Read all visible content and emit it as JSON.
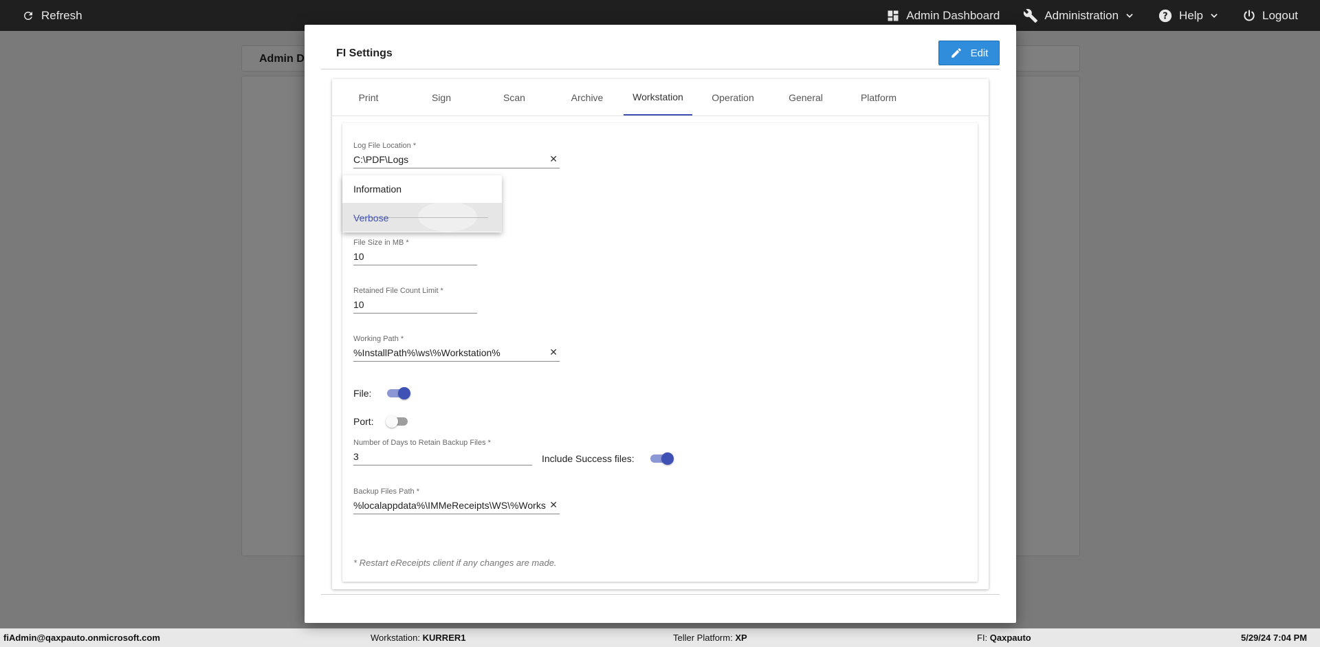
{
  "topbar": {
    "refresh_label": "Refresh",
    "admin_dashboard_label": "Admin Dashboard",
    "administration_label": "Administration",
    "help_label": "Help",
    "logout_label": "Logout"
  },
  "background": {
    "panel_title": "Admin D"
  },
  "modal": {
    "title": "FI Settings",
    "edit_label": "Edit",
    "tabs": [
      {
        "label": "Print"
      },
      {
        "label": "Sign"
      },
      {
        "label": "Scan"
      },
      {
        "label": "Archive"
      },
      {
        "label": "Workstation"
      },
      {
        "label": "Operation"
      },
      {
        "label": "General"
      },
      {
        "label": "Platform"
      }
    ],
    "active_tab": "Workstation",
    "fields": {
      "log_file_location": {
        "label": "Log File Location *",
        "value": "C:\\PDF\\Logs"
      },
      "file_size": {
        "label": "File Size in MB *",
        "value": "10"
      },
      "retained_count": {
        "label": "Retained File Count Limit *",
        "value": "10"
      },
      "working_path": {
        "label": "Working Path *",
        "value": "%InstallPath%\\ws\\%Workstation%"
      },
      "backup_days": {
        "label": "Number of Days to Retain Backup Files *",
        "value": "3"
      },
      "backup_path": {
        "label": "Backup Files Path *",
        "value": "%localappdata%\\IMMeReceipts\\WS\\%Workstation%"
      }
    },
    "toggles": {
      "file": {
        "label": "File:",
        "on": true
      },
      "port": {
        "label": "Port:",
        "on": false
      },
      "include_success": {
        "label": "Include Success files:",
        "on": true
      }
    },
    "log_level_dropdown": {
      "options": [
        "Information",
        "Verbose"
      ],
      "selected": "Verbose"
    },
    "note": "* Restart eReceipts client if any changes are made."
  },
  "statusbar": {
    "user": "fiAdmin@qaxpauto.onmicrosoft.com",
    "workstation_label": "Workstation:",
    "workstation_value": "KURRER1",
    "platform_label": "Teller Platform:",
    "platform_value": "XP",
    "fi_label": "FI:",
    "fi_value": "Qaxpauto",
    "datetime": "5/29/24 7:04 PM"
  },
  "colors": {
    "accent": "#3f51b5",
    "edit_button": "#2f8ddc",
    "topbar": "#1f1f1f"
  }
}
